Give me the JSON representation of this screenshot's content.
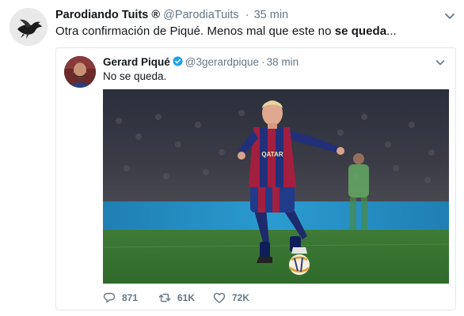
{
  "tweet": {
    "author": {
      "display_name": "Parodiando Tuits ®",
      "handle": "@ParodiaTuits",
      "avatar_icon": "bird-silhouette-icon"
    },
    "separator": "·",
    "time": "35 min",
    "text_before": "Otra confirmación de Piqué. Menos mal que este no ",
    "text_bold": "se queda",
    "text_after": "..."
  },
  "quoted_tweet": {
    "author": {
      "display_name": "Gerard Piqué",
      "handle": "@3gerardpique",
      "verified": true,
      "verified_color": "#1da1f2"
    },
    "separator": "·",
    "time": "38 min",
    "text": "No se queda.",
    "media": {
      "kind": "photo",
      "scene": "football player dribbling the ball on the pitch",
      "shirt_text": "QATAR"
    }
  },
  "actions": {
    "reply_count": "871",
    "retweet_count": "61K",
    "like_count": "72K"
  },
  "colors": {
    "text": "#14171a",
    "secondary_text": "#657786",
    "border": "#e1e8ed",
    "accent": "#1da1f2"
  }
}
